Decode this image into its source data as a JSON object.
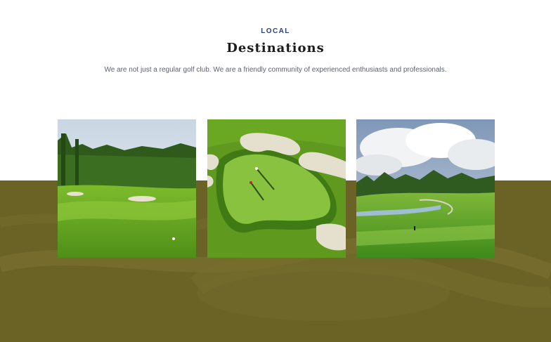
{
  "section": {
    "eyebrow": "LOCAL",
    "title": "Destinations",
    "subtitle": "We are not just a regular golf club. We are a friendly community of experienced enthusiasts and professionals."
  },
  "colors": {
    "band": "#6b6326",
    "eyebrow": "#2b3f7a",
    "title": "#1c1c1c",
    "subtitle": "#5c6270"
  },
  "cards": [
    {
      "image": "golf-fairway-forest-photo"
    },
    {
      "image": "golf-green-aerial-photo"
    },
    {
      "image": "golf-course-clouds-photo"
    }
  ]
}
